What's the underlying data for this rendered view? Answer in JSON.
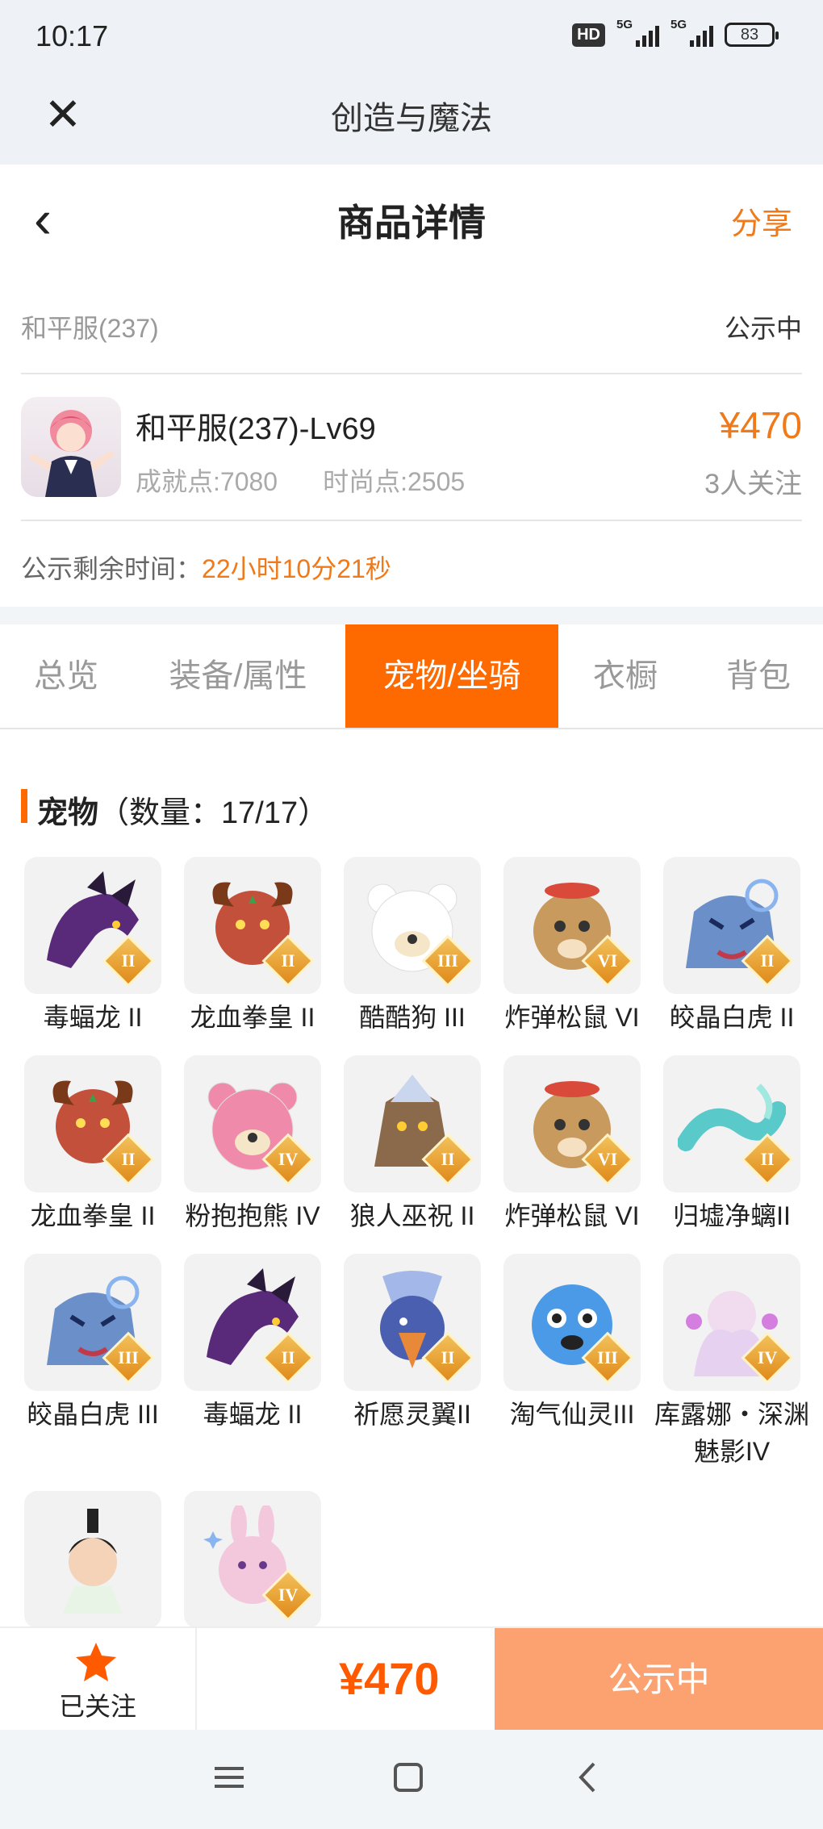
{
  "status_bar": {
    "time": "10:17",
    "hd": "HD",
    "net1": "5G",
    "net2": "5G",
    "battery": "83"
  },
  "app_bar": {
    "title": "创造与魔法"
  },
  "header": {
    "title": "商品详情",
    "share": "分享"
  },
  "listing": {
    "server": "和平服(237)",
    "status": "公示中",
    "name": "和平服(237)-Lv69",
    "achievement": "成就点:7080",
    "fashion": "时尚点:2505",
    "price": "¥470",
    "followers": "3人关注",
    "remaining_label": "公示剩余时间：",
    "remaining_value": "22小时10分21秒"
  },
  "tabs": [
    {
      "label": "总览",
      "active": false
    },
    {
      "label": "装备/属性",
      "active": false
    },
    {
      "label": "宠物/坐骑",
      "active": true
    },
    {
      "label": "衣橱",
      "active": false
    },
    {
      "label": "背包",
      "active": false
    }
  ],
  "section": {
    "title": "宠物",
    "count": "（数量：17/17）"
  },
  "pets": [
    {
      "name": "毒蝠龙 II",
      "rank": "II",
      "icon": "dragon-icon",
      "color": "#5a2a7a"
    },
    {
      "name": "龙血拳皇 II",
      "rank": "II",
      "icon": "ram-icon",
      "color": "#c2503a"
    },
    {
      "name": "酷酷狗 III",
      "rank": "III",
      "icon": "bear-icon",
      "color": "#ffffff"
    },
    {
      "name": "炸弹松鼠 VI",
      "rank": "VI",
      "icon": "squirrel-icon",
      "color": "#c99a5e"
    },
    {
      "name": "皎晶白虎 II",
      "rank": "II",
      "icon": "tiger-icon",
      "color": "#6a8fc9"
    },
    {
      "name": "龙血拳皇 II",
      "rank": "II",
      "icon": "ram-icon",
      "color": "#c2503a"
    },
    {
      "name": "粉抱抱熊 IV",
      "rank": "IV",
      "icon": "bear-icon",
      "color": "#f08aaa"
    },
    {
      "name": "狼人巫祝 II",
      "rank": "II",
      "icon": "wolf-icon",
      "color": "#8a6a4a"
    },
    {
      "name": "炸弹松鼠 VI",
      "rank": "VI",
      "icon": "squirrel-icon",
      "color": "#c99a5e"
    },
    {
      "name": "归墟净螭II",
      "rank": "II",
      "icon": "serpent-icon",
      "color": "#5ac9c9"
    },
    {
      "name": "皎晶白虎 III",
      "rank": "III",
      "icon": "tiger-icon",
      "color": "#6a8fc9"
    },
    {
      "name": "毒蝠龙 II",
      "rank": "II",
      "icon": "dragon-icon",
      "color": "#5a2a7a"
    },
    {
      "name": "祈愿灵翼II",
      "rank": "II",
      "icon": "bird-icon",
      "color": "#e8893a"
    },
    {
      "name": "淘气仙灵III",
      "rank": "III",
      "icon": "dog-icon",
      "color": "#4a9ae8"
    },
    {
      "name": "库露娜・深渊魅影IV",
      "rank": "IV",
      "icon": "fairy-icon",
      "color": "#e6d2f0"
    },
    {
      "name": "",
      "rank": "",
      "icon": "girl-icon",
      "color": "#f4d3b8"
    },
    {
      "name": "",
      "rank": "IV",
      "icon": "rabbit-icon",
      "color": "#f4c8dc"
    }
  ],
  "action_bar": {
    "followed": "已关注",
    "price": "¥470",
    "cta": "公示中"
  },
  "colors": {
    "accent": "#ff6a00",
    "price": "#f07a1a",
    "cta": "#fca271"
  }
}
